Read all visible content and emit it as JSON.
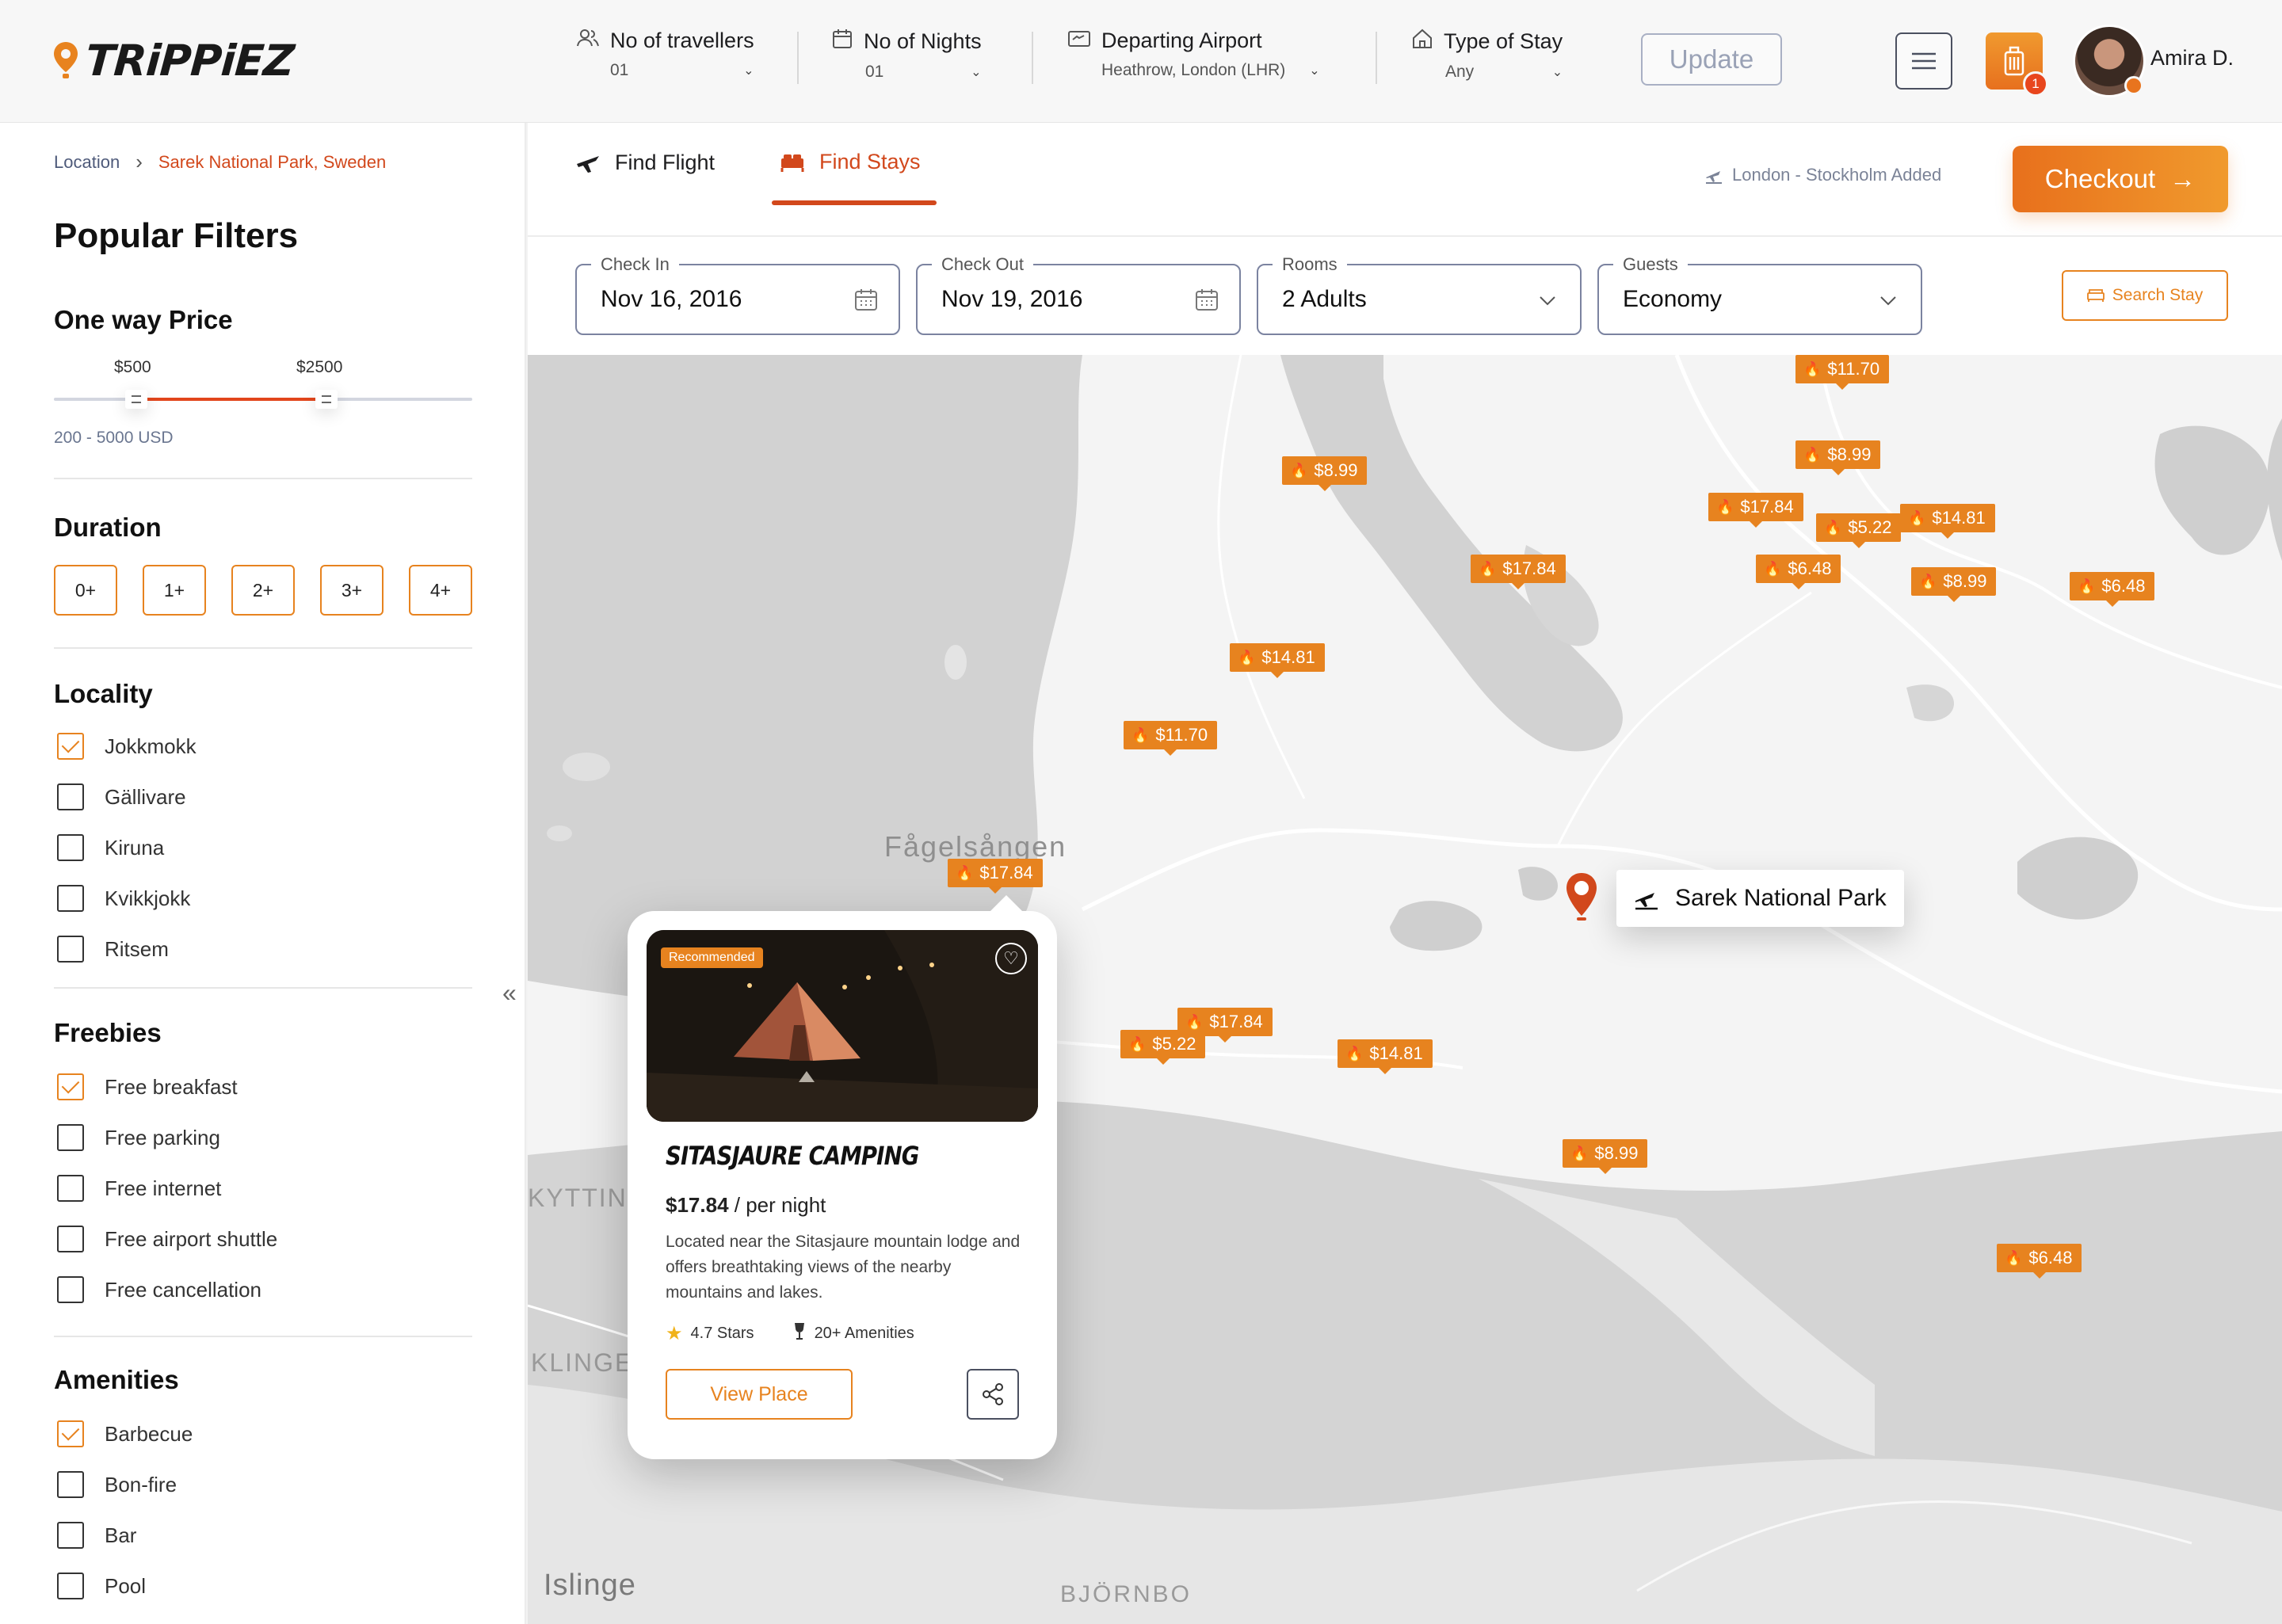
{
  "app": {
    "logo": "TRiPPiEZ"
  },
  "header": {
    "travellers": {
      "label": "No of travellers",
      "value": "01"
    },
    "nights": {
      "label": "No of Nights",
      "value": "01"
    },
    "airport": {
      "label": "Departing Airport",
      "value": "Heathrow, London (LHR)"
    },
    "stay": {
      "label": "Type of Stay",
      "value": "Any"
    },
    "update_label": "Update",
    "cart_count": "1",
    "user_name": "Amira D."
  },
  "breadcrumb": {
    "root": "Location",
    "current": "Sarek National Park, Sweden"
  },
  "filters": {
    "title": "Popular Filters",
    "price": {
      "heading": "One way Price",
      "min_label": "$500",
      "max_label": "$2500",
      "range_text": "200 - 5000 USD",
      "min": 500,
      "max": 2500
    },
    "duration": {
      "heading": "Duration",
      "options": [
        "0+",
        "1+",
        "2+",
        "3+",
        "4+"
      ]
    },
    "locality": {
      "heading": "Locality",
      "items": [
        {
          "label": "Jokkmokk",
          "checked": true
        },
        {
          "label": "Gällivare",
          "checked": false
        },
        {
          "label": "Kiruna",
          "checked": false
        },
        {
          "label": "Kvikkjokk",
          "checked": false
        },
        {
          "label": "Ritsem",
          "checked": false
        }
      ]
    },
    "freebies": {
      "heading": "Freebies",
      "items": [
        {
          "label": "Free breakfast",
          "checked": true
        },
        {
          "label": "Free parking",
          "checked": false
        },
        {
          "label": "Free internet",
          "checked": false
        },
        {
          "label": "Free airport shuttle",
          "checked": false
        },
        {
          "label": "Free cancellation",
          "checked": false
        }
      ]
    },
    "amenities": {
      "heading": "Amenities",
      "items": [
        {
          "label": "Barbecue",
          "checked": true
        },
        {
          "label": "Bon-fire",
          "checked": false
        },
        {
          "label": "Bar",
          "checked": false
        },
        {
          "label": "Pool",
          "checked": false
        }
      ]
    }
  },
  "tabs": [
    {
      "label": "Find Flight",
      "icon": "plane-icon",
      "active": false
    },
    {
      "label": "Find Stays",
      "icon": "bed-icon",
      "active": true
    }
  ],
  "added_text": "London - Stockholm Added",
  "checkout_label": "Checkout",
  "search": {
    "check_in": {
      "legend": "Check In",
      "value": "Nov 16, 2016"
    },
    "check_out": {
      "legend": "Check Out",
      "value": "Nov 19, 2016"
    },
    "rooms": {
      "legend": "Rooms",
      "value": "2 Adults"
    },
    "guests": {
      "legend": "Guests",
      "value": "Economy"
    },
    "button_label": "Search Stay"
  },
  "map": {
    "place_labels": [
      "Fågelsången",
      "KYTTING",
      "KLINGE",
      "Islinge",
      "BJÖRNBO"
    ],
    "park_name": "Sarek National Park",
    "price_tags": [
      "$11.70",
      "$8.99",
      "$8.99",
      "$17.84",
      "$5.22",
      "$14.81",
      "$17.84",
      "$6.48",
      "$8.99",
      "$6.48",
      "$14.81",
      "$11.70",
      "$17.84",
      "$17.84",
      "$5.22",
      "$14.81",
      "$8.99",
      "$6.48"
    ]
  },
  "card": {
    "badge": "Recommended",
    "title": "SITASJAURE CAMPING",
    "price": "$17.84",
    "price_suffix": "/ per night",
    "description": "Located near the Sitasjaure mountain lodge and offers breathtaking views of the nearby mountains and lakes.",
    "stars": "4.7 Stars",
    "amenities": "20+ Amenities",
    "view_label": "View Place"
  }
}
